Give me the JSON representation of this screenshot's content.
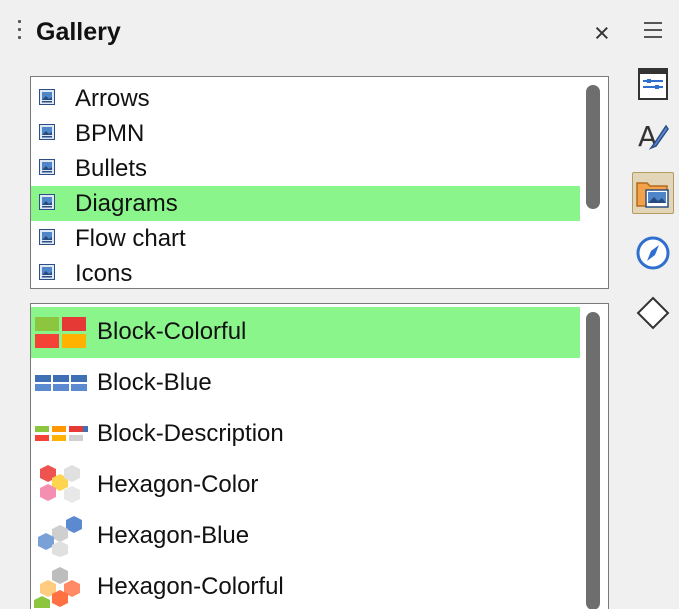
{
  "header": {
    "title": "Gallery",
    "close_glyph": "×"
  },
  "categories": [
    {
      "label": "Arrows",
      "icon": "gallery-theme-icon",
      "selected": false
    },
    {
      "label": "BPMN",
      "icon": "gallery-theme-icon",
      "selected": false
    },
    {
      "label": "Bullets",
      "icon": "gallery-theme-icon",
      "selected": false
    },
    {
      "label": "Diagrams",
      "icon": "gallery-theme-icon",
      "selected": true
    },
    {
      "label": "Flow chart",
      "icon": "gallery-theme-icon",
      "selected": false
    },
    {
      "label": "Icons",
      "icon": "gallery-theme-icon",
      "selected": false
    }
  ],
  "items": [
    {
      "label": "Block-Colorful",
      "thumb": "block-colorful-thumb",
      "selected": true
    },
    {
      "label": "Block-Blue",
      "thumb": "block-blue-thumb",
      "selected": false
    },
    {
      "label": "Block-Description",
      "thumb": "block-description-thumb",
      "selected": false
    },
    {
      "label": "Hexagon-Color",
      "thumb": "hexagon-color-thumb",
      "selected": false
    },
    {
      "label": "Hexagon-Blue",
      "thumb": "hexagon-blue-thumb",
      "selected": false
    },
    {
      "label": "Hexagon-Colorful",
      "thumb": "hexagon-colorful-thumb",
      "selected": false
    }
  ],
  "sidebar": {
    "menu_icon": "hamburger-menu-icon",
    "tabs": [
      {
        "icon": "properties-icon",
        "active": false
      },
      {
        "icon": "styles-icon",
        "active": false
      },
      {
        "icon": "gallery-icon",
        "active": true
      },
      {
        "icon": "navigator-icon",
        "active": false
      },
      {
        "icon": "shapes-icon",
        "active": false
      }
    ]
  },
  "colors": {
    "selection": "#8af58a",
    "active_tab": "#e3d6b8"
  }
}
